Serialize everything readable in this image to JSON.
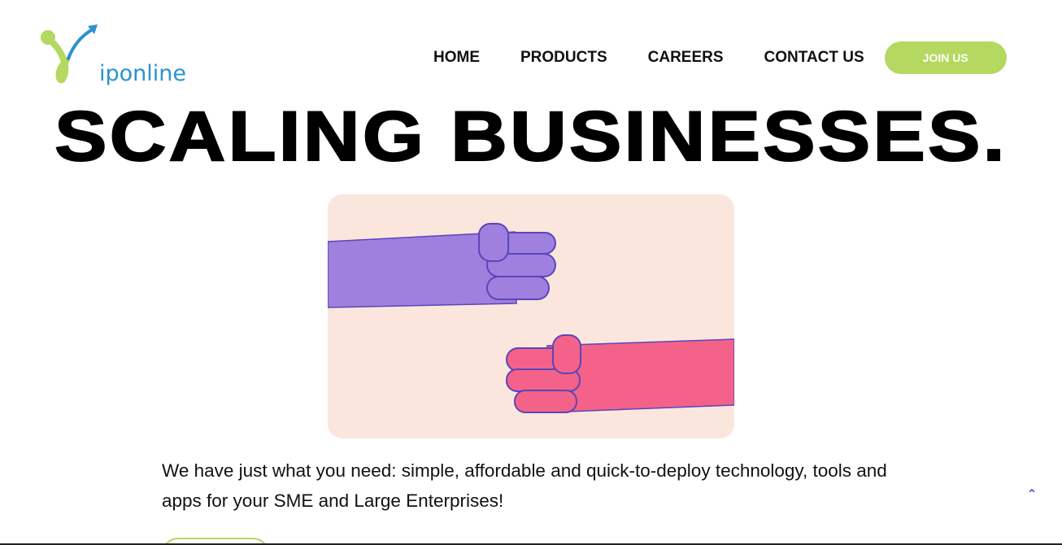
{
  "brand": {
    "name": "iponline",
    "accent": "#b5d860",
    "blue": "#2a93cf"
  },
  "nav": {
    "items": [
      "HOME",
      "PRODUCTS",
      "CAREERS",
      "CONTACT US"
    ],
    "cta": "JOIN US"
  },
  "hero": {
    "headline": "SCALING BUSINESSES.",
    "illustration": {
      "background": "#fbe6dd",
      "fist_top_color": "#9f80df",
      "fist_bottom_color": "#f4628a",
      "outline": "#5b45b8"
    },
    "description": "We have just what you need: simple, affordable and quick-to-deploy technology, tools and apps for your SME and Large Enterprises!"
  },
  "icons": {
    "scroll_top": "chevron-up-icon"
  }
}
